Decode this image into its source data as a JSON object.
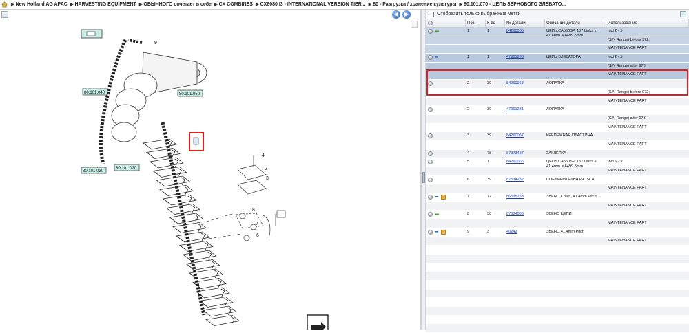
{
  "breadcrumb": {
    "items": [
      "New Holland AG APAC",
      "HARVESTING EQUIPMENT",
      "ОБЫЧНОГО сочетает в себе",
      "CX COMBINES",
      "CX6080 I3 - INTERNATIONAL VERSION TIER...",
      "80 - Разгрузка / хранение культуры",
      "80.101.070 - ЦЕПЬ ЗЕРНОВОГО ЭЛЕВАТО..."
    ]
  },
  "filter": {
    "label": "Отобразить только выбранные метки"
  },
  "columns": {
    "pos": "Поз.",
    "qty": "К-во",
    "part": "№ детали",
    "desc": "Описание детали",
    "use": "Использование"
  },
  "rows": [
    {
      "icons": [
        "dot",
        "arrow-green"
      ],
      "pos": "1",
      "qty": "1",
      "part": "84260065",
      "desc": "ЦЕПЬ,CA550SP, 157 Links x 41.4mm = 6499.8mm",
      "use": "Incl 2 - 5",
      "style": "sel"
    },
    {
      "icons": [],
      "pos": "",
      "qty": "",
      "part": "",
      "desc": "",
      "use": "(S/N Range) before 972;",
      "style": "sel"
    },
    {
      "icons": [],
      "pos": "",
      "qty": "",
      "part": "",
      "desc": "",
      "use": "MAINTENANCE PART",
      "style": "sel"
    },
    {
      "icons": [
        "dot",
        "arrow-blue"
      ],
      "pos": "1",
      "qty": "1",
      "part": "47961233",
      "desc": "ЦЕПЬ ЭЛЕВАТОРА",
      "use": "Incl 2 - 5",
      "style": "sel2"
    },
    {
      "icons": [],
      "pos": "",
      "qty": "",
      "part": "",
      "desc": "",
      "use": "(S/N Range) after 973;",
      "style": "sel2"
    },
    {
      "icons": [],
      "pos": "",
      "qty": "",
      "part": "",
      "desc": "",
      "use": "MAINTENANCE PART",
      "style": "sel2"
    },
    {
      "icons": [
        "dot"
      ],
      "pos": "2",
      "qty": "39",
      "part": "84260068",
      "desc": "ЛОПАТКА",
      "use": "",
      "style": "alt"
    },
    {
      "icons": [],
      "pos": "",
      "qty": "",
      "part": "",
      "desc": "",
      "use": "(S/N Range) before 972;",
      "style": ""
    },
    {
      "icons": [],
      "pos": "",
      "qty": "",
      "part": "",
      "desc": "",
      "use": "MAINTENANCE PART",
      "style": "alt"
    },
    {
      "icons": [
        "dot"
      ],
      "pos": "2",
      "qty": "39",
      "part": "47961231",
      "desc": "ЛОПАТКА",
      "use": "",
      "style": ""
    },
    {
      "icons": [],
      "pos": "",
      "qty": "",
      "part": "",
      "desc": "",
      "use": "(S/N Range) after 973;",
      "style": "alt"
    },
    {
      "icons": [],
      "pos": "",
      "qty": "",
      "part": "",
      "desc": "",
      "use": "MAINTENANCE PART",
      "style": ""
    },
    {
      "icons": [
        "dot"
      ],
      "pos": "3",
      "qty": "39",
      "part": "84260067",
      "desc": "КРЕПЕЖНАЯ ПЛАСТИНА",
      "use": "",
      "style": "alt"
    },
    {
      "icons": [],
      "pos": "",
      "qty": "",
      "part": "",
      "desc": "",
      "use": "MAINTENANCE PART",
      "style": ""
    },
    {
      "icons": [
        "dot"
      ],
      "pos": "4",
      "qty": "78",
      "part": "87373427",
      "desc": "ЗАКЛЕПКА",
      "use": "",
      "style": "alt"
    },
    {
      "icons": [
        "dot"
      ],
      "pos": "5",
      "qty": "1",
      "part": "84260066",
      "desc": "ЦЕПЬ,CA550SP, 157 Links x 41.4mm = 6499.8mm",
      "use": "Incl 6 - 9",
      "style": ""
    },
    {
      "icons": [],
      "pos": "",
      "qty": "",
      "part": "",
      "desc": "",
      "use": "MAINTENANCE PART",
      "style": "alt"
    },
    {
      "icons": [
        "dot"
      ],
      "pos": "6",
      "qty": "39",
      "part": "87534282",
      "desc": "СОЕДИНИТЕЛЬНАЯ ТЯГА",
      "use": "",
      "style": ""
    },
    {
      "icons": [],
      "pos": "",
      "qty": "",
      "part": "",
      "desc": "",
      "use": "MAINTENANCE PART",
      "style": "alt"
    },
    {
      "icons": [
        "dot",
        "arrow-blue",
        "box"
      ],
      "pos": "7",
      "qty": "77",
      "part": "86595253",
      "desc": "ЗВЕНО,Chain, 41.4mm Pitch",
      "use": "",
      "style": ""
    },
    {
      "icons": [],
      "pos": "",
      "qty": "",
      "part": "",
      "desc": "",
      "use": "MAINTENANCE PART",
      "style": "alt"
    },
    {
      "icons": [
        "dot",
        "arrow-green"
      ],
      "pos": "8",
      "qty": "38",
      "part": "87534086",
      "desc": "ЗВЕНО ЦЕПИ",
      "use": "",
      "style": ""
    },
    {
      "icons": [],
      "pos": "",
      "qty": "",
      "part": "",
      "desc": "",
      "use": "MAINTENANCE PART",
      "style": "alt"
    },
    {
      "icons": [
        "dot",
        "arrow-blue",
        "box"
      ],
      "pos": "9",
      "qty": "3",
      "part": "40242",
      "desc": "ЗВЕНО,41.4mm Pitch",
      "use": "",
      "style": ""
    },
    {
      "icons": [],
      "pos": "",
      "qty": "",
      "part": "",
      "desc": "",
      "use": "MAINTENANCE PART",
      "style": "alt"
    },
    {
      "icons": [],
      "pos": "",
      "qty": "",
      "part": "",
      "desc": "",
      "use": "",
      "style": ""
    },
    {
      "icons": [],
      "pos": "",
      "qty": "",
      "part": "",
      "desc": "",
      "use": "",
      "style": "alt"
    },
    {
      "icons": [],
      "pos": "",
      "qty": "",
      "part": "",
      "desc": "",
      "use": "",
      "style": ""
    },
    {
      "icons": [],
      "pos": "",
      "qty": "",
      "part": "",
      "desc": "",
      "use": "",
      "style": "alt"
    },
    {
      "icons": [],
      "pos": "",
      "qty": "",
      "part": "",
      "desc": "",
      "use": "",
      "style": ""
    },
    {
      "icons": [],
      "pos": "",
      "qty": "",
      "part": "",
      "desc": "",
      "use": "",
      "style": "alt"
    },
    {
      "icons": [],
      "pos": "",
      "qty": "",
      "part": "",
      "desc": "",
      "use": "",
      "style": ""
    },
    {
      "icons": [],
      "pos": "",
      "qty": "",
      "part": "",
      "desc": "",
      "use": "",
      "style": "alt"
    },
    {
      "icons": [],
      "pos": "",
      "qty": "",
      "part": "",
      "desc": "",
      "use": "",
      "style": ""
    },
    {
      "icons": [],
      "pos": "",
      "qty": "",
      "part": "",
      "desc": "",
      "use": "",
      "style": "alt"
    }
  ],
  "drawing": {
    "refs": [
      "80.101.040",
      "80.101.050",
      "80.101.030",
      "80.101.020"
    ],
    "callouts": [
      "9",
      "4",
      "2",
      "3",
      "8",
      "7",
      "6",
      "5"
    ]
  },
  "colors": {
    "selection": "#c6d4e5",
    "highlight": "#e02020",
    "link": "#1a3db8",
    "ref_box": "#c8eee6"
  }
}
